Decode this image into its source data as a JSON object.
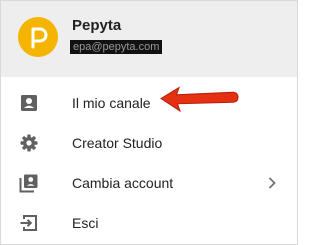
{
  "account": {
    "name": "Pepyta",
    "email": "epa@pepyta.com",
    "avatar_color": "#f4b400",
    "avatar_icon": "p-letter-icon"
  },
  "menu": {
    "items": [
      {
        "label": "Il mio canale",
        "icon": "account-box-icon"
      },
      {
        "label": "Creator Studio",
        "icon": "gear-icon"
      },
      {
        "label": "Cambia account",
        "icon": "switch-account-icon",
        "has_submenu": true
      },
      {
        "label": "Esci",
        "icon": "exit-icon"
      }
    ]
  },
  "annotation": {
    "arrow_color": "#e53012",
    "arrow_icon": "red-arrow-icon"
  }
}
